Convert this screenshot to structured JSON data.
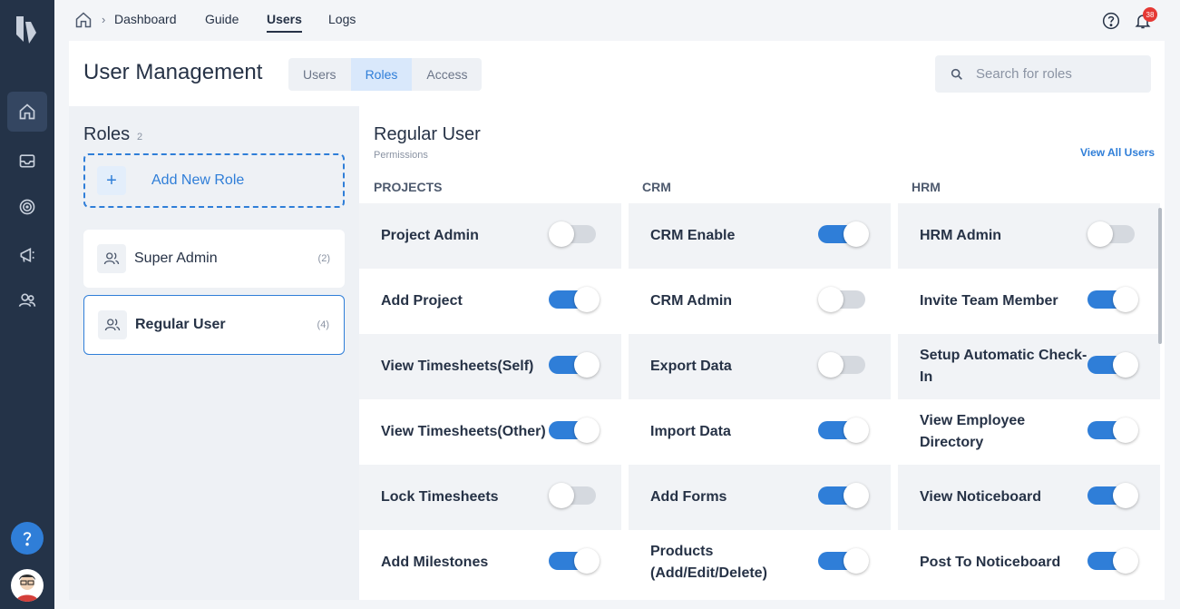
{
  "nav": {
    "items": [
      {
        "label": "Dashboard",
        "active": false
      },
      {
        "label": "Guide",
        "active": false
      },
      {
        "label": "Users",
        "active": true
      },
      {
        "label": "Logs",
        "active": false
      }
    ],
    "notification_count": "38"
  },
  "page": {
    "title": "User Management",
    "tabs": [
      {
        "label": "Users",
        "active": false
      },
      {
        "label": "Roles",
        "active": true
      },
      {
        "label": "Access",
        "active": false
      }
    ],
    "search_placeholder": "Search for roles"
  },
  "roles": {
    "title": "Roles",
    "count": "2",
    "add_label": "Add New Role",
    "items": [
      {
        "name": "Super Admin",
        "count": "(2)",
        "selected": false
      },
      {
        "name": "Regular User",
        "count": "(4)",
        "selected": true
      }
    ]
  },
  "permissions": {
    "role_name": "Regular User",
    "subtitle": "Permissions",
    "view_all_label": "View All Users",
    "columns": [
      {
        "heading": "PROJECTS",
        "items": [
          {
            "label": "Project Admin",
            "enabled": false
          },
          {
            "label": "Add Project",
            "enabled": true
          },
          {
            "label": "View Timesheets(Self)",
            "enabled": true
          },
          {
            "label": "View Timesheets(Other)",
            "enabled": true
          },
          {
            "label": "Lock Timesheets",
            "enabled": false
          },
          {
            "label": "Add Milestones",
            "enabled": true
          }
        ]
      },
      {
        "heading": "CRM",
        "items": [
          {
            "label": "CRM Enable",
            "enabled": true
          },
          {
            "label": "CRM Admin",
            "enabled": false
          },
          {
            "label": "Export Data",
            "enabled": false
          },
          {
            "label": "Import Data",
            "enabled": true
          },
          {
            "label": "Add Forms",
            "enabled": true
          },
          {
            "label": "Products (Add/Edit/Delete)",
            "enabled": true
          }
        ]
      },
      {
        "heading": "HRM",
        "items": [
          {
            "label": "HRM Admin",
            "enabled": false
          },
          {
            "label": "Invite Team Member",
            "enabled": true
          },
          {
            "label": "Setup Automatic Check-In",
            "enabled": true
          },
          {
            "label": "View Employee Directory",
            "enabled": true
          },
          {
            "label": "View Noticeboard",
            "enabled": true
          },
          {
            "label": "Post To Noticeboard",
            "enabled": true
          }
        ]
      }
    ]
  },
  "colors": {
    "accent": "#2f7ed8",
    "sidebar": "#243348",
    "badge": "#e53935"
  }
}
